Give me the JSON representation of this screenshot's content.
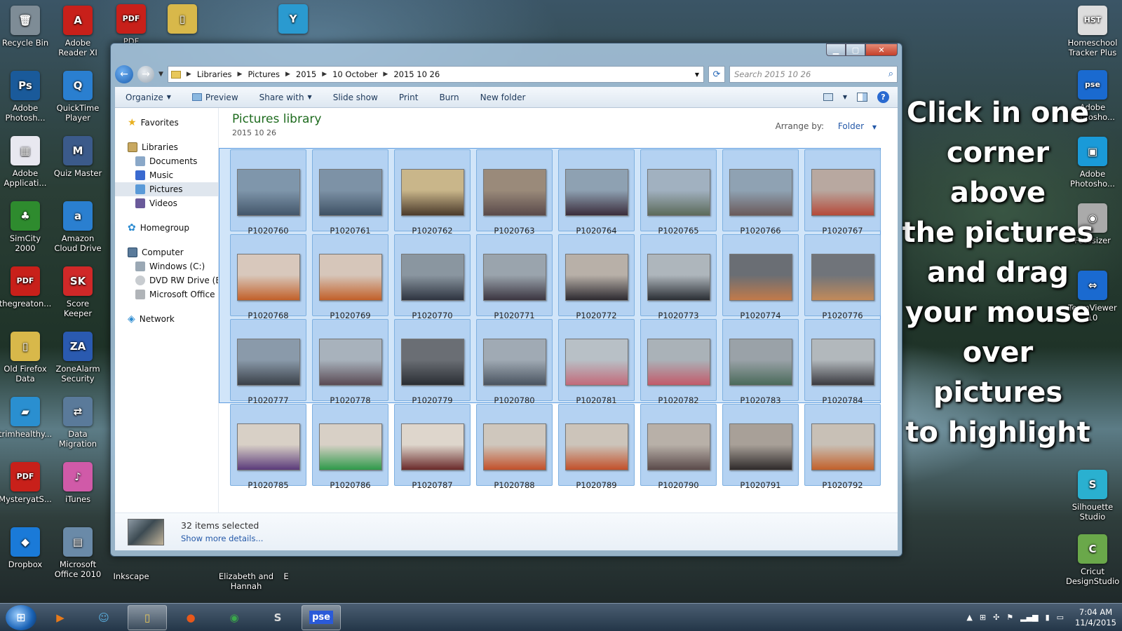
{
  "desktop": {
    "icons_left": [
      {
        "label": "Recycle Bin",
        "color": "#7e8c96",
        "glyph": "🗑"
      },
      {
        "label": "Adobe Reader XI",
        "color": "#c8201a",
        "glyph": "A"
      },
      {
        "label": "Adobe Photosh...",
        "color": "#1a5a9a",
        "glyph": "Ps"
      },
      {
        "label": "QuickTime Player",
        "color": "#2a7fd0",
        "glyph": "Q"
      },
      {
        "label": "Adobe Applicati...",
        "color": "#e8e8f0",
        "glyph": "▦"
      },
      {
        "label": "Quiz Master",
        "color": "#3b5a8a",
        "glyph": "M"
      },
      {
        "label": "SimCity 2000",
        "color": "#2e8b2e",
        "glyph": "♣"
      },
      {
        "label": "Amazon Cloud Drive",
        "color": "#2a7fd0",
        "glyph": "a"
      },
      {
        "label": "thegreaton...",
        "color": "#c8201a",
        "glyph": "PDF"
      },
      {
        "label": "Score Keeper",
        "color": "#d02828",
        "glyph": "SK"
      },
      {
        "label": "Old Firefox Data",
        "color": "#d8b84a",
        "glyph": "▯"
      },
      {
        "label": "ZoneAlarm Security",
        "color": "#2a5ab0",
        "glyph": "ZA"
      },
      {
        "label": "trimhealthy...",
        "color": "#2a8fd0",
        "glyph": "▰"
      },
      {
        "label": "Data Migration",
        "color": "#5a7a9a",
        "glyph": "⇄"
      },
      {
        "label": "MysteryatS...",
        "color": "#c8201a",
        "glyph": "PDF"
      },
      {
        "label": "iTunes",
        "color": "#d05aa8",
        "glyph": "♪"
      },
      {
        "label": "Dropbox",
        "color": "#1a7ad8",
        "glyph": "◆"
      },
      {
        "label": "Microsoft Office 2010",
        "color": "#6a8aa8",
        "glyph": "▤"
      }
    ],
    "icons_top": [
      {
        "label": "PDF",
        "color": "#c8201a",
        "glyph": "PDF"
      },
      {
        "label": "",
        "color": "#d8b84a",
        "glyph": "▯"
      },
      {
        "label": "",
        "color": "#2a9ad0",
        "glyph": "Y"
      }
    ],
    "icons_bottom": [
      {
        "label": "Inkscape"
      },
      {
        "label": "Elizabeth and Hannah"
      },
      {
        "label": "E"
      }
    ],
    "icons_right": [
      {
        "label": "Homeschool Tracker Plus",
        "color": "#ddd",
        "glyph": "HST"
      },
      {
        "label": "Adobe Photosho...",
        "color": "#1a6ad0",
        "glyph": "pse"
      },
      {
        "label": "Adobe Photosho...",
        "color": "#1a9ad8",
        "glyph": "▣"
      },
      {
        "label": "Fotosizer",
        "color": "#aaa",
        "glyph": "◉"
      },
      {
        "label": "TeamViewer 10",
        "color": "#1a6ad0",
        "glyph": "⇔"
      },
      {
        "label": "Silhouette Studio",
        "color": "#2ab0d0",
        "glyph": "S"
      },
      {
        "label": "Cricut DesignStudio",
        "color": "#6aa84a",
        "glyph": "C"
      }
    ],
    "instruction_lines": [
      "Click in one",
      "corner above",
      "the pictures",
      "and drag",
      "your mouse",
      "over pictures",
      "to highlight"
    ]
  },
  "window": {
    "breadcrumbs": [
      "Libraries",
      "Pictures",
      "2015",
      "10 October",
      "2015 10 26"
    ],
    "search_placeholder": "Search 2015 10 26",
    "toolbar": {
      "organize": "Organize",
      "preview": "Preview",
      "share_with": "Share with",
      "slide_show": "Slide show",
      "print": "Print",
      "burn": "Burn",
      "new_folder": "New folder"
    },
    "nav": {
      "favorites": "Favorites",
      "libraries": "Libraries",
      "library_items": [
        "Documents",
        "Music",
        "Pictures",
        "Videos"
      ],
      "selected_library": "Pictures",
      "homegroup": "Homegroup",
      "computer": "Computer",
      "computer_items": [
        "Windows (C:)",
        "DVD RW Drive (E:) I",
        "Microsoft Office Cl"
      ],
      "network": "Network"
    },
    "library_title": "Pictures library",
    "library_subtitle": "2015 10 26",
    "arrange_label": "Arrange by:",
    "arrange_value": "Folder",
    "files": [
      {
        "name": "P1020760",
        "sel": true,
        "c1": "#7f96ab",
        "c2": "#43566a"
      },
      {
        "name": "P1020761",
        "sel": true,
        "c1": "#7d92a6",
        "c2": "#3e5164"
      },
      {
        "name": "P1020762",
        "sel": true,
        "c1": "#c9b68a",
        "c2": "#4b3a2b"
      },
      {
        "name": "P1020763",
        "sel": true,
        "c1": "#9a8a7a",
        "c2": "#5a4a4a"
      },
      {
        "name": "P1020764",
        "sel": true,
        "c1": "#8ea1b2",
        "c2": "#3b2d3c"
      },
      {
        "name": "P1020765",
        "sel": true,
        "c1": "#a1b1c0",
        "c2": "#5c6a5a"
      },
      {
        "name": "P1020766",
        "sel": true,
        "c1": "#8fa2b3",
        "c2": "#6a5a5a"
      },
      {
        "name": "P1020767",
        "sel": true,
        "c1": "#b8a8a0",
        "c2": "#b54a3a"
      },
      {
        "name": "P1020768",
        "sel": true,
        "c1": "#d8c8bc",
        "c2": "#c2602a"
      },
      {
        "name": "P1020769",
        "sel": true,
        "c1": "#d6c6ba",
        "c2": "#c2602a"
      },
      {
        "name": "P1020770",
        "sel": true,
        "c1": "#8a96a0",
        "c2": "#2e3440"
      },
      {
        "name": "P1020771",
        "sel": true,
        "c1": "#9aa4ad",
        "c2": "#3b3540"
      },
      {
        "name": "P1020772",
        "sel": true,
        "c1": "#b8b0a8",
        "c2": "#2d2a30"
      },
      {
        "name": "P1020773",
        "sel": true,
        "c1": "#aeb6bc",
        "c2": "#2a2e34"
      },
      {
        "name": "P1020774",
        "sel": true,
        "c1": "#6a6e74",
        "c2": "#c27a4a"
      },
      {
        "name": "P1020776",
        "sel": true,
        "c1": "#70747a",
        "c2": "#c28a5a"
      },
      {
        "name": "P1020777",
        "sel": true,
        "c1": "#8a9aaa",
        "c2": "#3a4048"
      },
      {
        "name": "P1020778",
        "sel": true,
        "c1": "#a8b2bc",
        "c2": "#5a4a54"
      },
      {
        "name": "P1020779",
        "sel": true,
        "c1": "#6a6e74",
        "c2": "#2a2e34"
      },
      {
        "name": "P1020780",
        "sel": true,
        "c1": "#a0aab4",
        "c2": "#4a5460"
      },
      {
        "name": "P1020781",
        "sel": true,
        "c1": "#b8c0c6",
        "c2": "#c26a7a"
      },
      {
        "name": "P1020782",
        "sel": true,
        "c1": "#aab2b8",
        "c2": "#c25a6a"
      },
      {
        "name": "P1020783",
        "sel": true,
        "c1": "#9aa2a8",
        "c2": "#4a6a5a"
      },
      {
        "name": "P1020784",
        "sel": true,
        "c1": "#b2b8bc",
        "c2": "#3a3a40"
      },
      {
        "name": "P1020785",
        "sel": true,
        "c1": "#d8d0c6",
        "c2": "#5a3a7a"
      },
      {
        "name": "P1020786",
        "sel": true,
        "c1": "#d8d0c6",
        "c2": "#2e9a4a"
      },
      {
        "name": "P1020787",
        "sel": true,
        "c1": "#ded6cc",
        "c2": "#6a2a2a"
      },
      {
        "name": "P1020788",
        "sel": true,
        "c1": "#cfc7bd",
        "c2": "#c2502a"
      },
      {
        "name": "P1020789",
        "sel": true,
        "c1": "#ccc4ba",
        "c2": "#c2502a"
      },
      {
        "name": "P1020790",
        "sel": true,
        "c1": "#b8b0a8",
        "c2": "#5a4a4a"
      },
      {
        "name": "P1020791",
        "sel": true,
        "c1": "#a8a098",
        "c2": "#2e2a2a"
      },
      {
        "name": "P1020792",
        "sel": true,
        "c1": "#c8c0b6",
        "c2": "#c2602a"
      }
    ],
    "details": {
      "count": "32 items selected",
      "more": "Show more details..."
    }
  },
  "taskbar": {
    "buttons": [
      {
        "name": "media-player",
        "glyph": "▶",
        "color": "#e87a1a"
      },
      {
        "name": "people",
        "glyph": "☺",
        "color": "#5ab0e0"
      },
      {
        "name": "explorer",
        "glyph": "▯",
        "color": "#e8c85a",
        "active": true
      },
      {
        "name": "firefox",
        "glyph": "●",
        "color": "#e8581a"
      },
      {
        "name": "chrome",
        "glyph": "◉",
        "color": "#3aa84a"
      },
      {
        "name": "silhouette",
        "glyph": "S",
        "color": "#dddddd"
      },
      {
        "name": "pse",
        "glyph": "pse",
        "color": "#2a5ad8",
        "active": true
      }
    ],
    "time": "7:04 AM",
    "date": "11/4/2015"
  }
}
